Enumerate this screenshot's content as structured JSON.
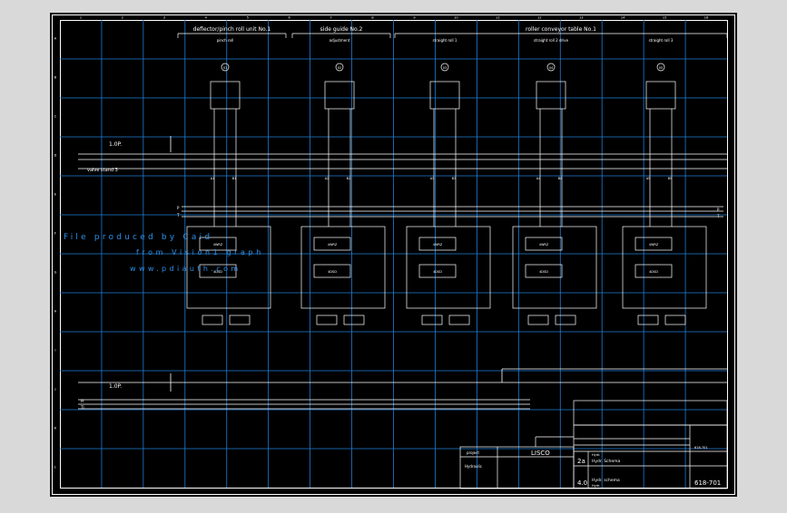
{
  "drawing": {
    "columns": [
      "1",
      "2",
      "3",
      "4",
      "5",
      "6",
      "7",
      "8",
      "9",
      "10",
      "11",
      "12",
      "13",
      "14",
      "15",
      "16"
    ],
    "rows": [
      "A",
      "B",
      "C",
      "D",
      "E",
      "F",
      "G",
      "H",
      "I",
      "J",
      "K",
      "L"
    ],
    "sections": [
      "deflector/pinch roll unit No.1",
      "side guide No.2",
      "roller conveyor table No.1"
    ],
    "subsections": [
      "pinch roll",
      "adjustment",
      "straight roll 1",
      "straight roll 2 drive",
      "straight roll 3"
    ],
    "actuators": [
      {
        "tag": "01",
        "label": "pinch roll",
        "valve": "4WRZ",
        "valve2": "4DSD",
        "code_a": "A1",
        "code_b": "B1"
      },
      {
        "tag": "02",
        "label": "adjustment",
        "valve": "4WRZ",
        "valve2": "4DSD",
        "code_a": "A2",
        "code_b": "B2"
      },
      {
        "tag": "03",
        "label": "straight roll 1",
        "valve": "4WRZ",
        "valve2": "4DSD",
        "code_a": "A3",
        "code_b": "B3"
      },
      {
        "tag": "04",
        "label": "straight roll 2 drive",
        "valve": "4WRZ",
        "valve2": "4DSD",
        "code_a": "A4",
        "code_b": "B4"
      },
      {
        "tag": "05",
        "label": "straight roll 3",
        "valve": "4WRZ",
        "valve2": "4DSD",
        "code_a": "A5",
        "code_b": "B5"
      }
    ],
    "labels": {
      "top_level": "1.0P.",
      "bottom_level": "1.0P.",
      "valve_stand": "valve stand 3",
      "line_p": "P",
      "line_t": "T",
      "line_pl": "Pl",
      "line_tl": "Tl"
    },
    "watermark": {
      "line1": "File produced by Caid",
      "line2": "from Vision1 graph",
      "line3": "www.pdiauth.com"
    },
    "title_block": {
      "project": "project",
      "hydraulic": "Hydraulic",
      "lang": "LISCO",
      "revision": "2a",
      "revision2": "4.0",
      "title1": "Hydr. Schema",
      "title2": "Hydr. schema",
      "sub1": "Hydr.",
      "sub2": "Hydr.",
      "drawing_no": "618-701",
      "drawing_no_small": "618-701"
    }
  }
}
